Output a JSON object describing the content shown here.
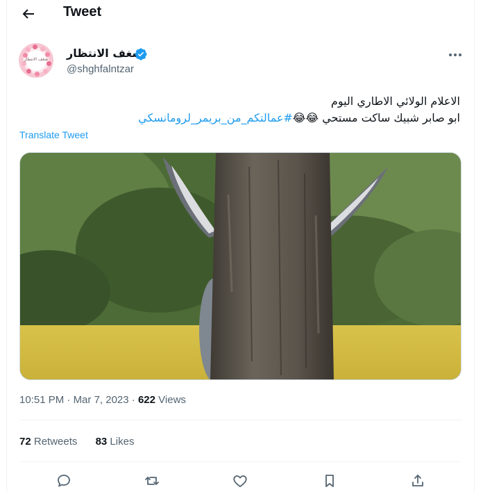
{
  "header": {
    "title": "Tweet",
    "back_icon": "arrow-left-icon"
  },
  "author": {
    "display_name": "شغف الانتظار",
    "handle": "@shghfalntzar",
    "avatar_text": "شغف الانتظار",
    "verified_color": "#1d9bf0"
  },
  "tweet": {
    "line1": "الاعلام الولائي الاطاري اليوم",
    "line2_text": "ابو صابر شبيك ساكت مستحي 😂😂",
    "hashtag": "#عمالتكم_من_بريمر_لرومانسكي",
    "translate_label": "Translate Tweet"
  },
  "meta": {
    "time": "10:51 PM",
    "date": "Mar 7, 2023",
    "views_count": "622",
    "views_label": "Views"
  },
  "stats": {
    "retweets_count": "72",
    "retweets_label": "Retweets",
    "likes_count": "83",
    "likes_label": "Likes"
  },
  "actions": [
    "reply-icon",
    "retweet-icon",
    "like-icon",
    "bookmark-icon",
    "share-icon"
  ],
  "colors": {
    "accent": "#1d9bf0",
    "text": "#0f1419",
    "secondary": "#536471",
    "border": "#eff3f4"
  }
}
